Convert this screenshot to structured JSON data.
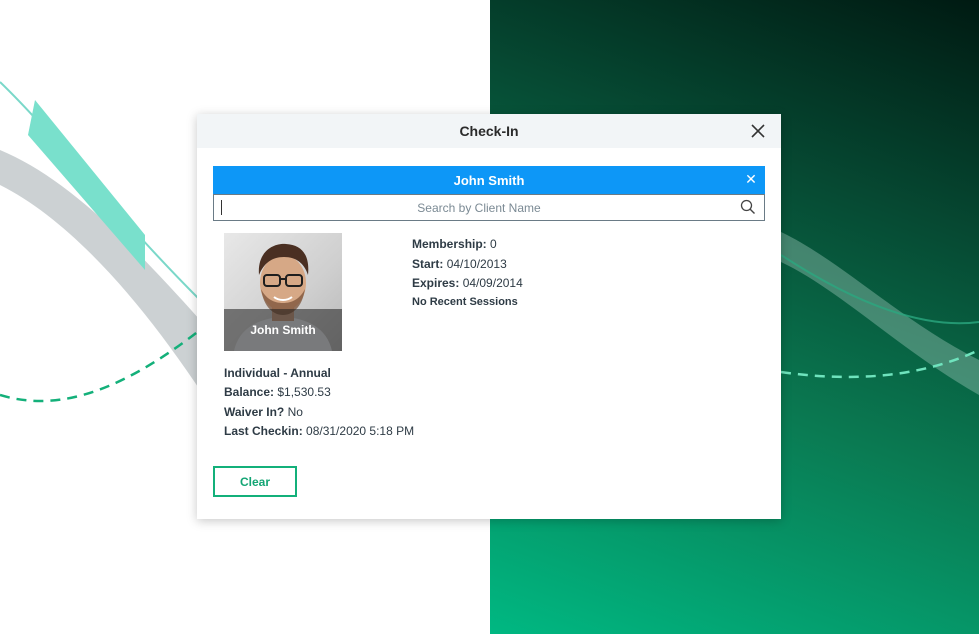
{
  "modal": {
    "title": "Check-In"
  },
  "client_bar": {
    "name": "John Smith"
  },
  "search": {
    "placeholder": "Search by Client Name",
    "value": ""
  },
  "photo": {
    "caption": "John Smith"
  },
  "membership": {
    "membership_label": "Membership:",
    "membership_value": "0",
    "start_label": "Start:",
    "start_value": "04/10/2013",
    "expires_label": "Expires:",
    "expires_value": "04/09/2014",
    "sessions_note": "No Recent Sessions"
  },
  "account": {
    "plan": "Individual - Annual",
    "balance_label": "Balance:",
    "balance_value": "$1,530.53",
    "waiver_label": "Waiver In?",
    "waiver_value": "No",
    "last_checkin_label": "Last Checkin:",
    "last_checkin_value": "08/31/2020 5:18 PM"
  },
  "actions": {
    "clear_label": "Clear"
  },
  "colors": {
    "accent_blue": "#0d97f7",
    "accent_green": "#13b07a",
    "bg_dark_green": "#064a33"
  }
}
